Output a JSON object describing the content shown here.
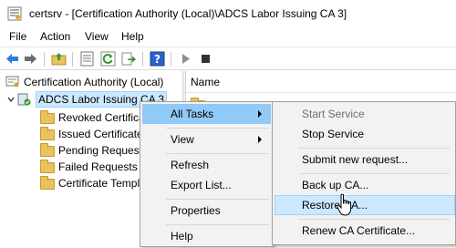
{
  "window": {
    "title": "certsrv - [Certification Authority (Local)\\ADCS Labor Issuing CA 3]"
  },
  "menubar": {
    "items": [
      "File",
      "Action",
      "View",
      "Help"
    ]
  },
  "toolbar": {
    "icons": [
      "back-arrow-icon",
      "forward-arrow-icon",
      "up-folder-icon",
      "properties-icon",
      "refresh-icon",
      "export-list-icon",
      "help-icon",
      "play-icon",
      "stop-icon"
    ]
  },
  "tree": {
    "root": "Certification Authority (Local)",
    "ca": "ADCS Labor Issuing CA 3",
    "folders": [
      "Revoked Certificates",
      "Issued Certificates",
      "Pending Requests",
      "Failed Requests",
      "Certificate Templates"
    ]
  },
  "list": {
    "header": "Name"
  },
  "context_menu": {
    "items": [
      "All Tasks",
      "View",
      "Refresh",
      "Export List...",
      "Properties",
      "Help"
    ]
  },
  "submenu": {
    "items": [
      "Start Service",
      "Stop Service",
      "Submit new request...",
      "Back up CA...",
      "Restore CA...",
      "Renew CA Certificate..."
    ]
  },
  "colors": {
    "highlight": "#91c9f7",
    "hover": "#cce8ff",
    "menu_bg": "#f2f2f2",
    "disabled_text": "#6d6d6d"
  }
}
